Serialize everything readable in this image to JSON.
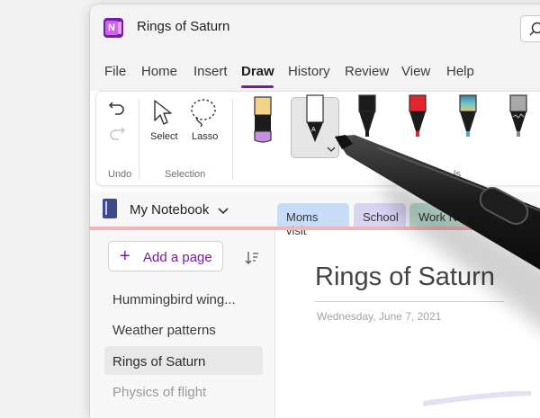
{
  "window": {
    "title": "Rings of Saturn",
    "app_icon": "onenote-icon",
    "search_icon": "search-icon"
  },
  "menu": {
    "tabs": [
      "File",
      "Home",
      "Insert",
      "Draw",
      "History",
      "Review",
      "View",
      "Help"
    ],
    "active": "Draw"
  },
  "ribbon": {
    "undo": {
      "group_label": "Undo",
      "undo_icon": "undo-icon",
      "redo_icon": "redo-icon"
    },
    "selection": {
      "group_label": "Selection",
      "select_label": "Select",
      "lasso_label": "Lasso"
    },
    "tools": {
      "group_label_partial": "ls",
      "pens": [
        {
          "name": "highlighter-yellow",
          "color": "#f1d38a"
        },
        {
          "name": "pen-white",
          "color": "#ffffff",
          "selected": true
        },
        {
          "name": "pen-black",
          "color": "#1c1c1c"
        },
        {
          "name": "pen-red",
          "color": "#e3242b"
        },
        {
          "name": "pen-galaxy",
          "color": "#4ea8c8"
        },
        {
          "name": "pen-glitter",
          "color": "#8a8a8a"
        }
      ]
    }
  },
  "notebook": {
    "name": "My Notebook",
    "sections": [
      {
        "label": "Moms visit",
        "color": "#c7ddf7"
      },
      {
        "label": "School",
        "color": "#d7d5f2"
      },
      {
        "label": "Work N",
        "color": "#bfe1d3"
      }
    ]
  },
  "pages": {
    "add_label": "Add a page",
    "items": [
      {
        "label": "Hummingbird wing..."
      },
      {
        "label": "Weather patterns"
      },
      {
        "label": "Rings of Saturn",
        "selected": true
      },
      {
        "label": "Physics of flight"
      }
    ]
  },
  "page": {
    "title": "Rings of Saturn",
    "date": "Wednesday, June 7, 2021"
  },
  "colors": {
    "accent": "#7719aa",
    "section_line": "#f1b5b8"
  }
}
